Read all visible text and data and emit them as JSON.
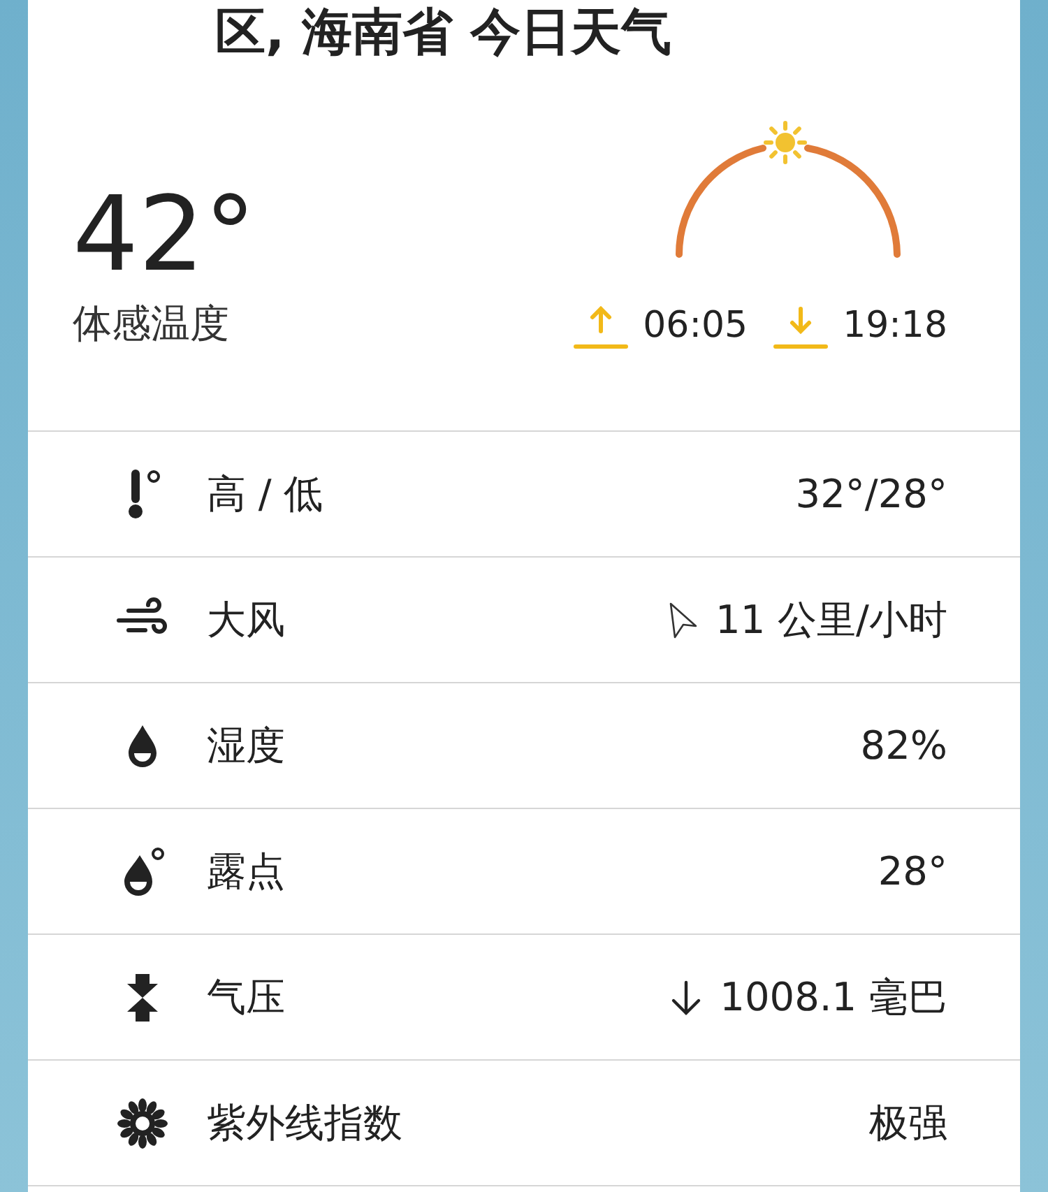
{
  "title": "区, 海南省 今日天气",
  "feels_like": {
    "temperature": "42°",
    "label": "体感温度"
  },
  "sun": {
    "sunrise": "06:05",
    "sunset": "19:18"
  },
  "rows": [
    {
      "kind": "temperature",
      "label": "高 / 低",
      "value": "32°/28°"
    },
    {
      "kind": "wind",
      "label": "大风",
      "value": "11 公里/小时"
    },
    {
      "kind": "humidity",
      "label": "湿度",
      "value": "82%"
    },
    {
      "kind": "dew_point",
      "label": "露点",
      "value": "28°"
    },
    {
      "kind": "pressure",
      "label": "气压",
      "value": "1008.1 毫巴",
      "falling": true
    },
    {
      "kind": "uv",
      "label": "紫外线指数",
      "value": "极强"
    }
  ]
}
